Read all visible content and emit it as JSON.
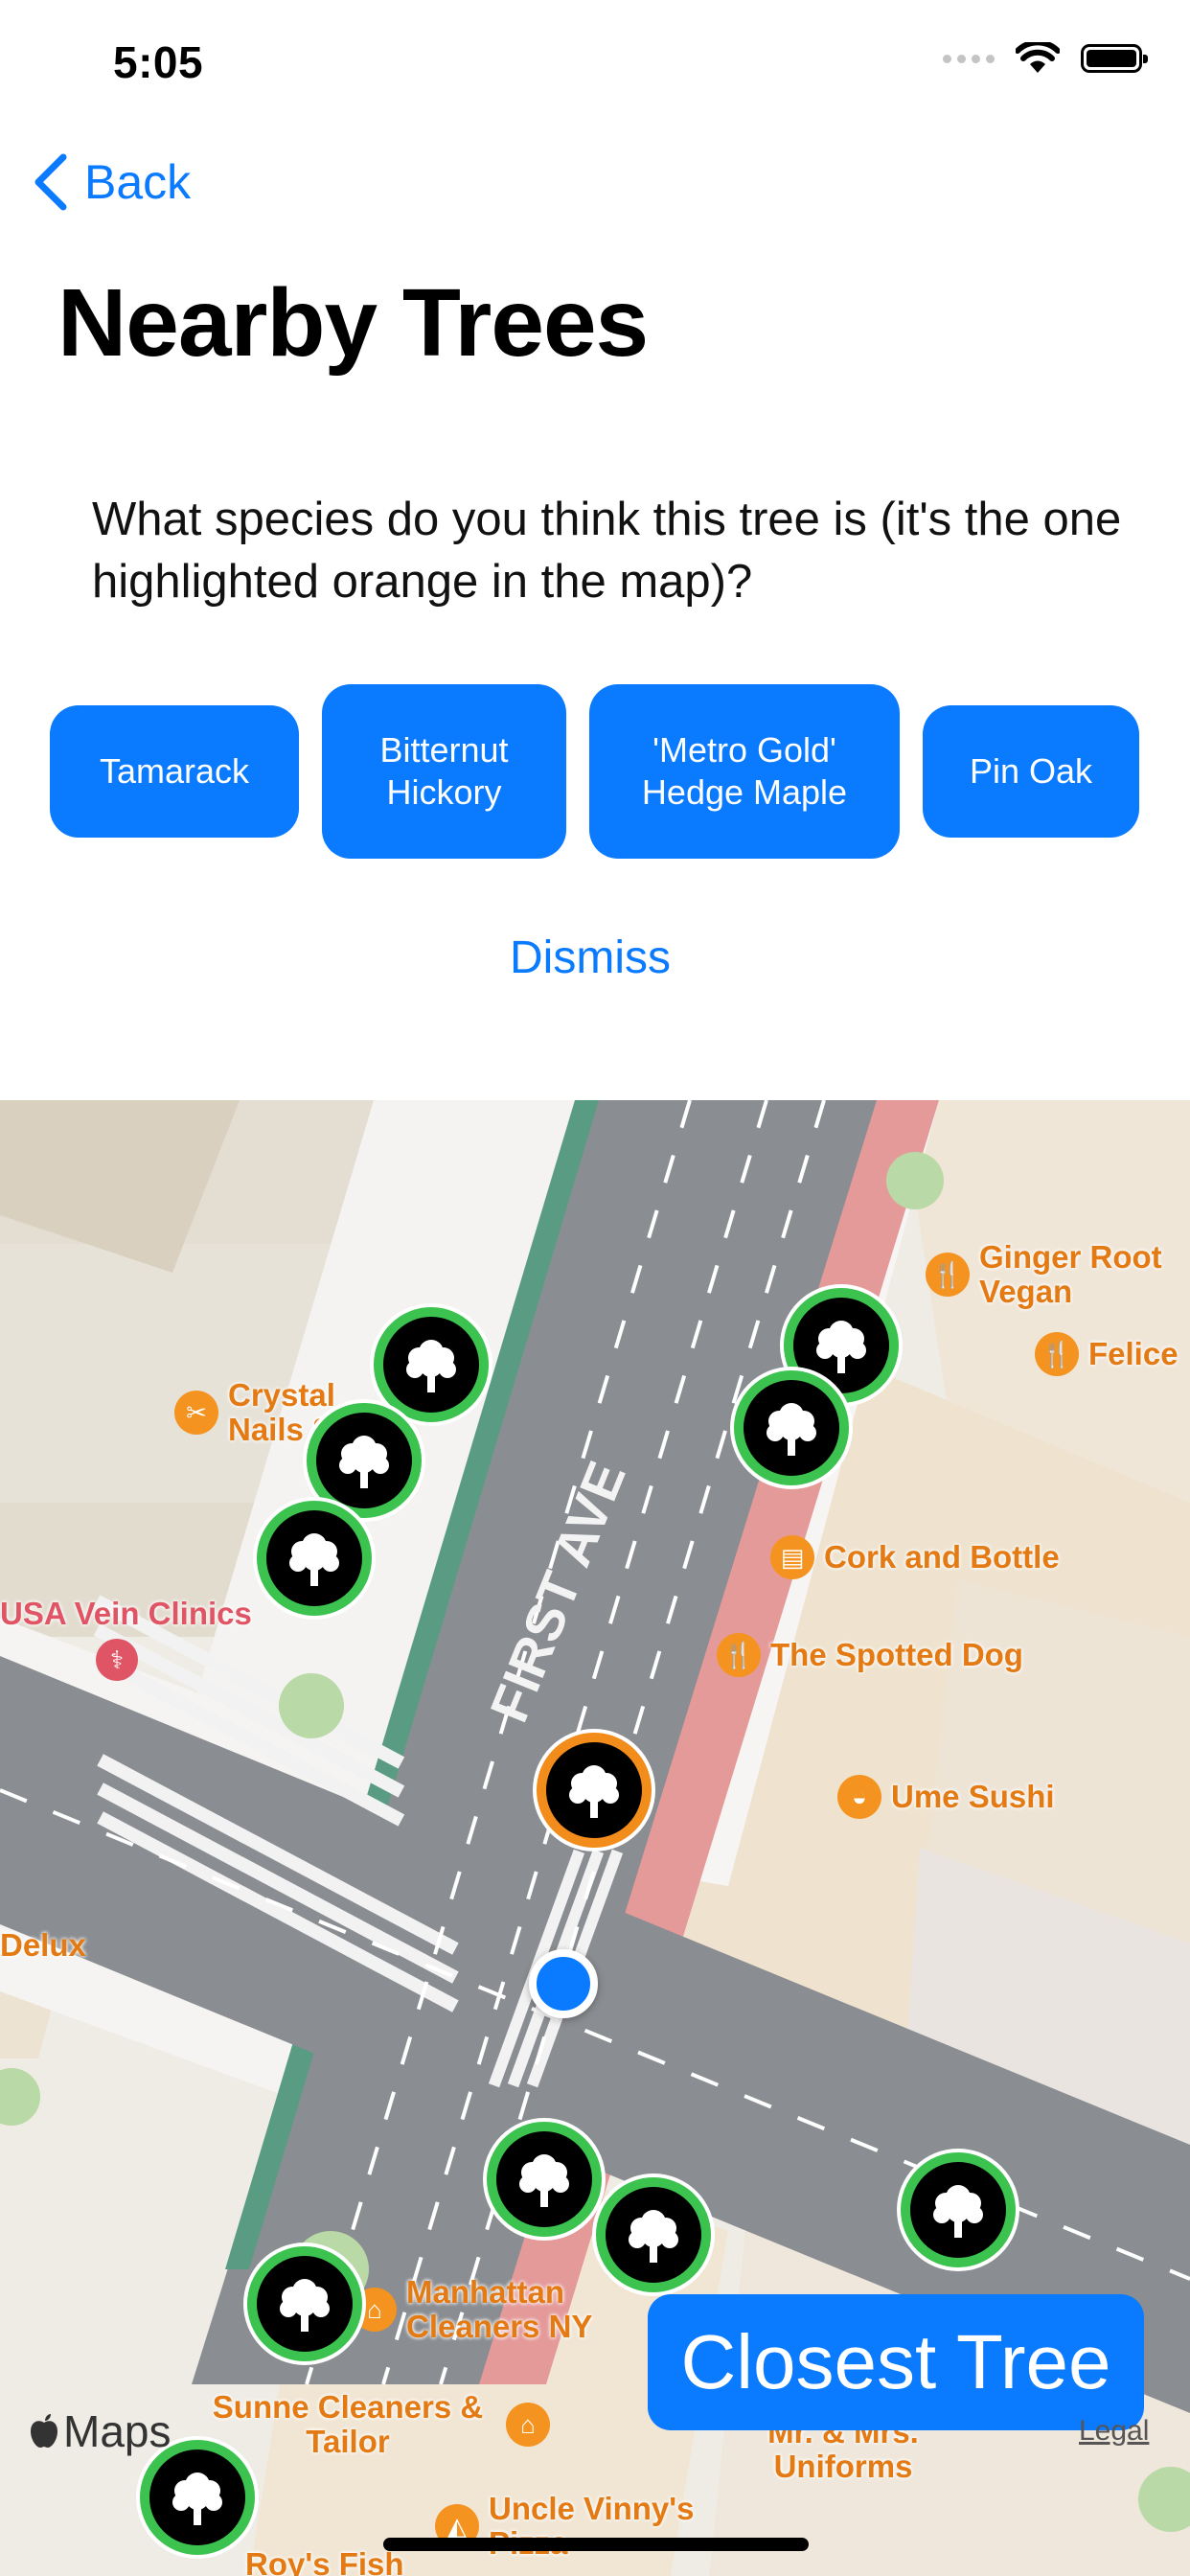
{
  "status_bar": {
    "time": "5:05"
  },
  "nav": {
    "back_label": "Back"
  },
  "page": {
    "title": "Nearby Trees"
  },
  "quiz": {
    "question": "What species do you think this tree is (it's the one highlighted orange in the map)?",
    "options": [
      "Tamarack",
      "Bitternut Hickory",
      "'Metro Gold' Hedge Maple",
      "Pin Oak"
    ],
    "dismiss_label": "Dismiss"
  },
  "map": {
    "street_label": "FIRST AVE",
    "poi": {
      "crystal_nails": "Crystal Nails S",
      "usa_vein": "USA Vein Clinics",
      "ginger_root": "Ginger Root Vegan",
      "felice": "Felice",
      "cork_bottle": "Cork and Bottle",
      "spotted_dog": "The Spotted Dog",
      "ume_sushi": "Ume Sushi",
      "delux": "Delux",
      "manhattan_cleaners": "Manhattan Cleaners NY",
      "sunne_cleaners": "Sunne Cleaners & Tailor",
      "mr_mrs": "Mr. & Mrs. Uniforms",
      "uncle_vinny": "Uncle Vinny's Pizza",
      "roys_fish": "Roy's Fish"
    },
    "closest_button": "Closest Tree",
    "maps_label": "Maps",
    "legal_label": "Legal",
    "colors": {
      "tree_marker_ring": "#3cc24f",
      "highlighted_marker_ring": "#f28c1a",
      "accent": "#0a7aff"
    }
  }
}
